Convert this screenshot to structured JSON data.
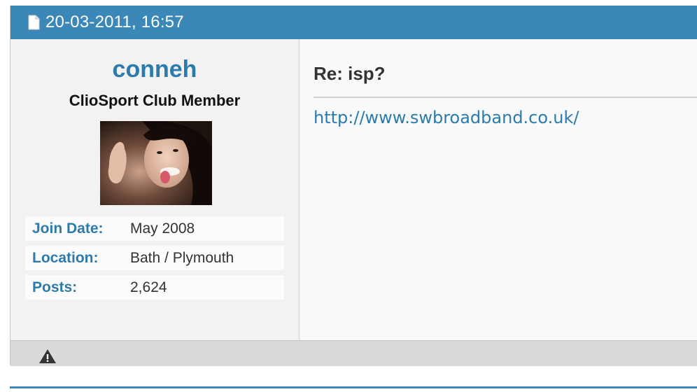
{
  "post": {
    "date": "20-03-2011, 16:57",
    "title": "Re: isp?",
    "link": "http://www.swbroadband.co.uk/"
  },
  "user": {
    "name": "conneh",
    "title": "ClioSport Club Member",
    "stats": [
      {
        "label": "Join Date:",
        "value": "May 2008"
      },
      {
        "label": "Location:",
        "value": "Bath / Plymouth"
      },
      {
        "label": "Posts:",
        "value": "2,624"
      }
    ]
  },
  "icons": {
    "post": "document-icon",
    "report": "warning-icon"
  },
  "colors": {
    "header": "#3a87b8",
    "accent": "#2b7cad",
    "footer": "#dadada"
  }
}
